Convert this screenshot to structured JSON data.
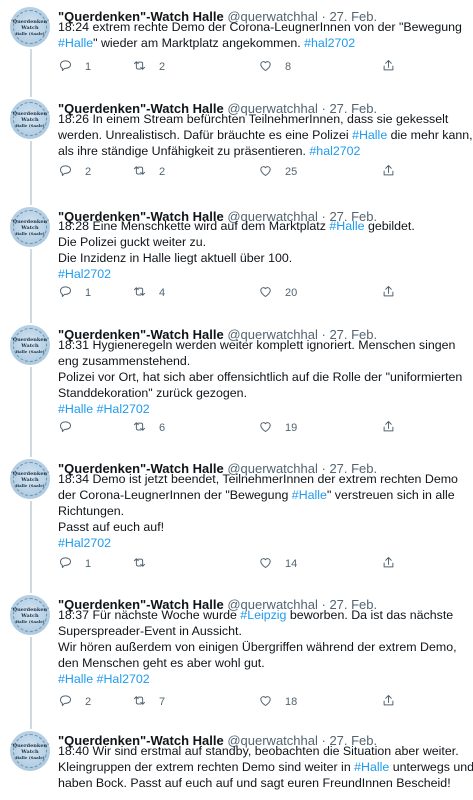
{
  "account": {
    "name": "\"Querdenken\"-Watch Halle",
    "handle": "@querwatchhal",
    "avatar_lines": [
      "\"Querdenken\"",
      "Watch",
      "Halle (Saale)"
    ]
  },
  "tweets": [
    {
      "date": "27. Feb.",
      "lines": [
        [
          {
            "t": "18:24 extrem rechte Demo der Corona-LeugnerInnen von der \"Bewegung"
          }
        ],
        [
          {
            "t": "#Halle",
            "link": true
          },
          {
            "t": "\" wieder am Marktplatz angekommen. "
          },
          {
            "t": "#hal2702",
            "link": true
          }
        ]
      ],
      "replies": "1",
      "retweets": "2",
      "likes": "8"
    },
    {
      "date": "27. Feb.",
      "lines": [
        [
          {
            "t": "18:26 In einem Stream befürchten TeilnehmerInnen, dass sie gekesselt"
          }
        ],
        [
          {
            "t": "werden. Unrealistisch. Dafür bräuchte es eine Polizei "
          },
          {
            "t": "#Halle",
            "link": true
          },
          {
            "t": " die mehr kann,"
          }
        ],
        [
          {
            "t": "als ihre ständige Unfähigkeit zu präsentieren.  "
          },
          {
            "t": "#hal2702",
            "link": true
          }
        ]
      ],
      "replies": "2",
      "retweets": "2",
      "likes": "25"
    },
    {
      "date": "27. Feb.",
      "lines": [
        [
          {
            "t": "18:28 Eine Menschkette wird auf dem Marktplatz "
          },
          {
            "t": "#Halle",
            "link": true
          },
          {
            "t": " gebildet."
          }
        ],
        [
          {
            "t": "Die Polizei guckt weiter zu."
          }
        ],
        [
          {
            "t": "Die Inzidenz in Halle liegt aktuell über 100."
          }
        ],
        [
          {
            "t": "#Hal2702",
            "link": true
          }
        ]
      ],
      "replies": "1",
      "retweets": "4",
      "likes": "20"
    },
    {
      "date": "27. Feb.",
      "lines": [
        [
          {
            "t": "18:31 Hygieneregeln werden weiter komplett ignoriert. Menschen singen"
          }
        ],
        [
          {
            "t": "eng zusammenstehend."
          }
        ],
        [
          {
            "t": "Polizei vor Ort, hat sich aber offensichtlich auf die Rolle der \"uniformierten"
          }
        ],
        [
          {
            "t": "Standdekoration\" zurück gezogen."
          }
        ],
        [
          {
            "t": "#Halle",
            "link": true
          },
          {
            "t": " "
          },
          {
            "t": "#Hal2702",
            "link": true
          }
        ]
      ],
      "replies": "",
      "retweets": "6",
      "likes": "19"
    },
    {
      "date": "27. Feb.",
      "lines": [
        [
          {
            "t": "18:34 Demo ist jetzt beendet, TeilnehmerInnen der extrem rechten Demo"
          }
        ],
        [
          {
            "t": "der Corona-LeugnerInnen der \"Bewegung "
          },
          {
            "t": "#Halle",
            "link": true
          },
          {
            "t": "\" verstreuen sich in alle"
          }
        ],
        [
          {
            "t": "Richtungen."
          }
        ],
        [
          {
            "t": "Passt auf euch auf!"
          }
        ],
        [
          {
            "t": "#Hal2702",
            "link": true
          }
        ]
      ],
      "replies": "1",
      "retweets": "",
      "likes": "14"
    },
    {
      "date": "27. Feb.",
      "lines": [
        [
          {
            "t": "18:37 Für nächste Woche wurde "
          },
          {
            "t": "#Leipzig",
            "link": true
          },
          {
            "t": " beworben. Da ist das nächste"
          }
        ],
        [
          {
            "t": "Superspreader-Event in Aussicht."
          }
        ],
        [
          {
            "t": "Wir hören außerdem von einigen Übergriffen während der extrem Demo,"
          }
        ],
        [
          {
            "t": "den Menschen geht es aber wohl gut."
          }
        ],
        [
          {
            "t": "#Halle",
            "link": true
          },
          {
            "t": " "
          },
          {
            "t": "#Hal2702",
            "link": true
          }
        ]
      ],
      "replies": "2",
      "retweets": "7",
      "likes": "18"
    },
    {
      "date": "27. Feb.",
      "lines": [
        [
          {
            "t": "18:40 Wir sind erstmal auf standby, beobachten die Situation aber weiter."
          }
        ],
        [
          {
            "t": "Kleingruppen der extrem rechten Demo sind weiter in "
          },
          {
            "t": "#Halle",
            "link": true
          },
          {
            "t": " unterwegs und"
          }
        ],
        [
          {
            "t": "haben Bock. Passt auf euch auf und sagt euren FreundInnen Bescheid!"
          }
        ]
      ],
      "replies": "",
      "retweets": "",
      "likes": ""
    }
  ],
  "icons": {
    "reply": "reply-icon",
    "retweet": "retweet-icon",
    "like": "heart-icon",
    "share": "share-icon"
  },
  "colors": {
    "link": "#1d9bf0",
    "muted": "#536471",
    "text": "#0f1419",
    "thread_line": "#cfd9de"
  }
}
